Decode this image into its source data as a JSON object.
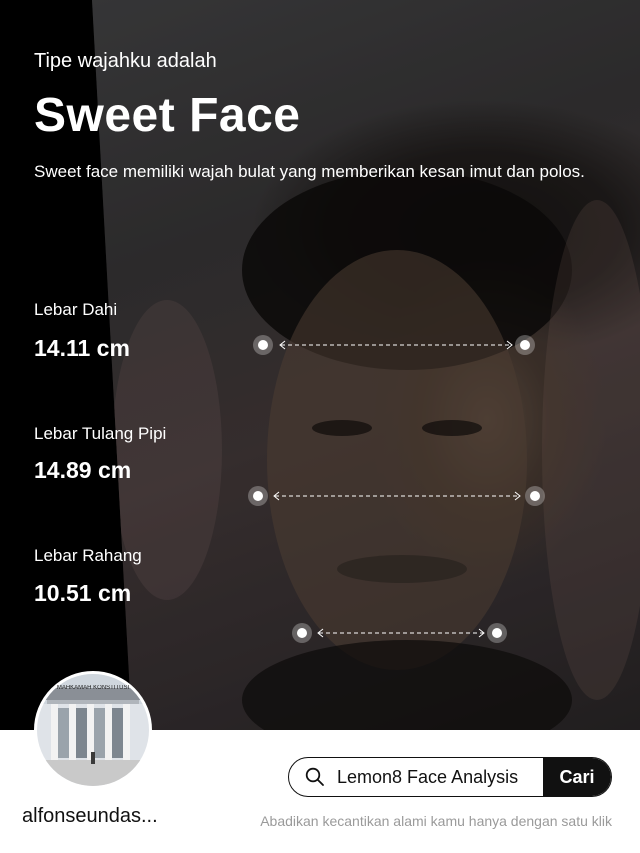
{
  "header": {
    "subtitle": "Tipe wajahku adalah",
    "title": "Sweet Face",
    "description": "Sweet face memiliki wajah bulat yang memberikan kesan imut dan polos."
  },
  "measurements": [
    {
      "label": "Lebar Dahi",
      "value": "14.11 cm"
    },
    {
      "label": "Lebar Tulang Pipi",
      "value": "14.89 cm"
    },
    {
      "label": "Lebar Rahang",
      "value": "10.51 cm"
    }
  ],
  "profile": {
    "username": "alfonseundas...",
    "avatar_sign_text": "MAHKAMAH KONSTITUSI"
  },
  "search": {
    "query": "Lemon8 Face Analysis",
    "button_label": "Cari",
    "icon": "search-icon"
  },
  "footer": {
    "tagline": "Abadikan kecantikan alami kamu hanya dengan satu klik"
  },
  "colors": {
    "background": "#000000",
    "panel": "#ffffff",
    "accent": "#111111",
    "muted_text": "#9a9a9a"
  }
}
